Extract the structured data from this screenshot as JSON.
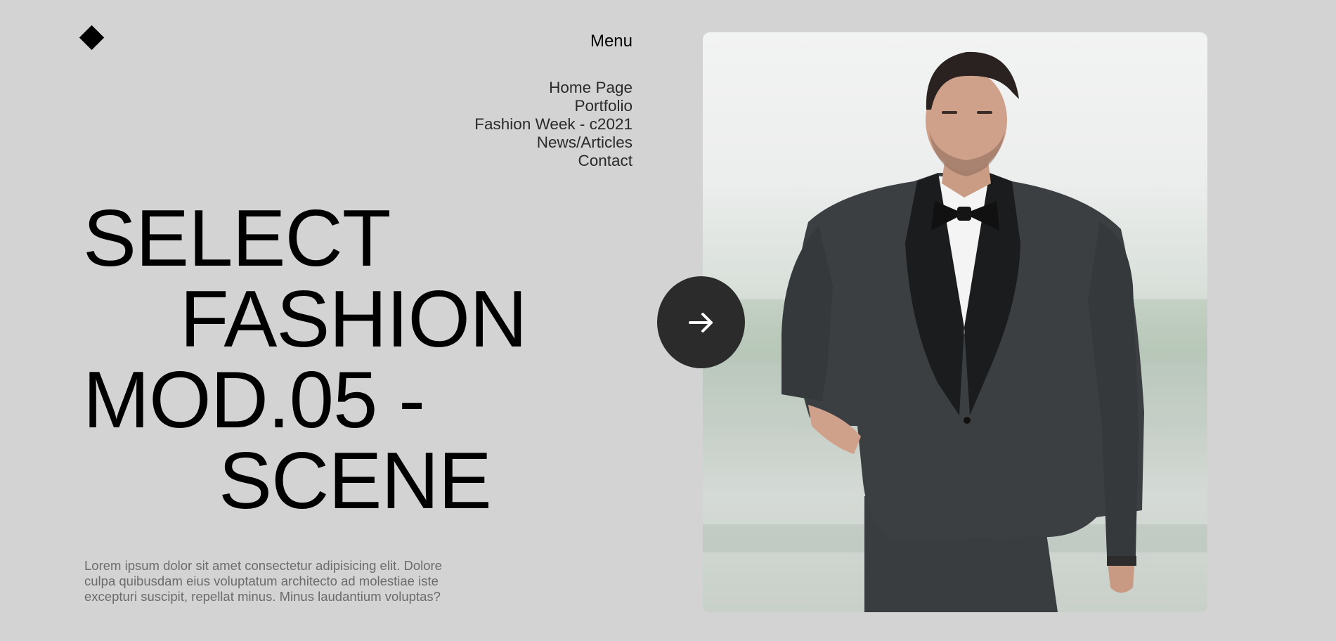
{
  "logo": {
    "icon": "diamond-logo-icon"
  },
  "menu": {
    "title": "Menu",
    "items": [
      {
        "label": "Home Page"
      },
      {
        "label": "Portfolio"
      },
      {
        "label": "Fashion Week - c2021"
      },
      {
        "label": "News/Articles"
      },
      {
        "label": "Contact"
      }
    ]
  },
  "hero": {
    "lines": [
      "SELECT",
      "FASHION",
      "MOD.05 -",
      "SCENE"
    ]
  },
  "description": "Lorem ipsum dolor sit amet consectetur adipisicing elit. Dolore culpa quibusdam eius voluptatum architecto ad molestiae iste excepturi suscipit, repellat minus. Minus laudantium voluptas?",
  "next_button": {
    "icon": "arrow-right-icon"
  },
  "photo": {
    "subject": "man in dark tuxedo with bow tie"
  },
  "colors": {
    "background": "#d3d3d3",
    "text": "#000000",
    "muted_text": "#6b6b6b",
    "button": "#2b2b2b",
    "button_icon": "#ffffff"
  }
}
